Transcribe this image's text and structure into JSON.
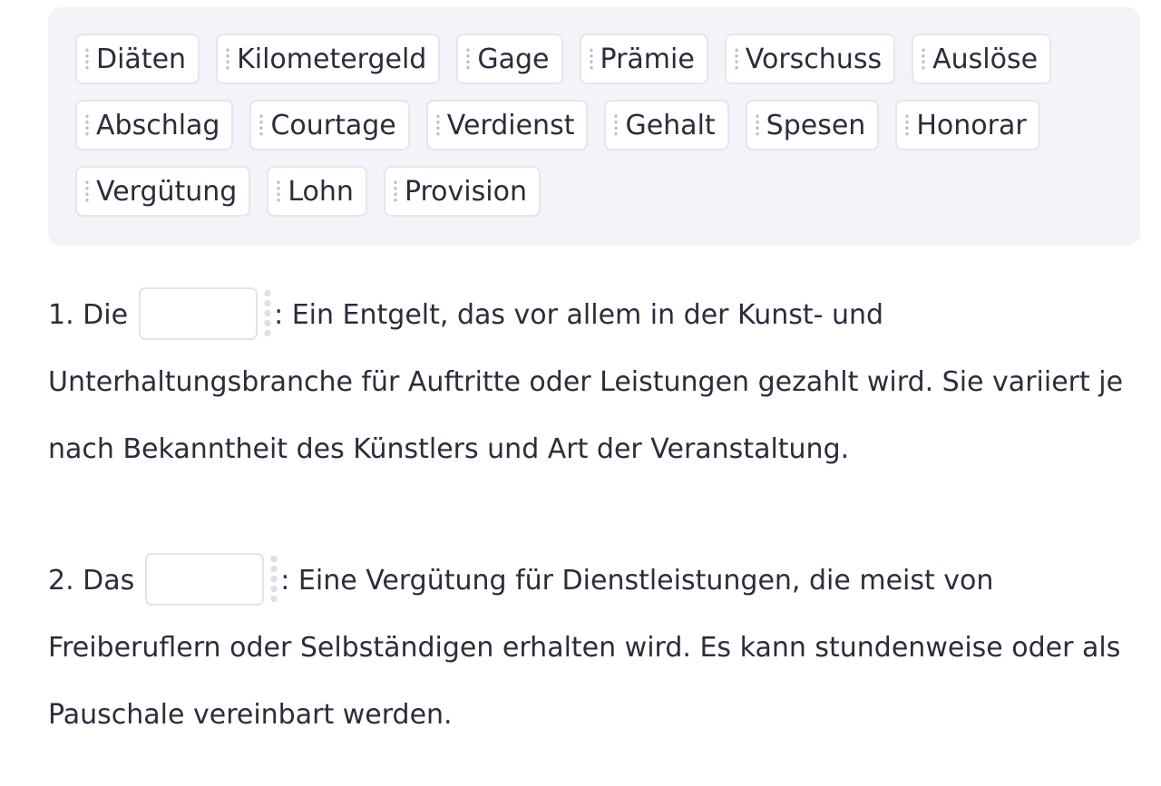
{
  "word_bank": {
    "rows": [
      [
        "Diäten",
        "Kilometergeld",
        "Gage",
        "Prämie",
        "Vorschuss",
        "Auslöse"
      ],
      [
        "Abschlag",
        "Courtage",
        "Verdienst",
        "Gehalt",
        "Spesen",
        "Honorar"
      ],
      [
        "Vergütung",
        "Lohn",
        "Provision"
      ]
    ]
  },
  "questions": [
    {
      "prefix": "1. Die",
      "text": ": Ein Entgelt, das vor allem in der Kunst- und Unterhaltungsbranche für Auftritte oder Leistungen gezahlt wird. Sie variiert je nach Bekanntheit des Künstlers und Art der Veranstaltung.",
      "answer": ""
    },
    {
      "prefix": "2. Das",
      "text": ": Eine Vergütung für Dienstleistungen, die meist von Freiberuflern oder Selbständigen erhalten wird. Es kann stundenweise oder als Pauschale vereinbart werden.",
      "answer": ""
    }
  ]
}
